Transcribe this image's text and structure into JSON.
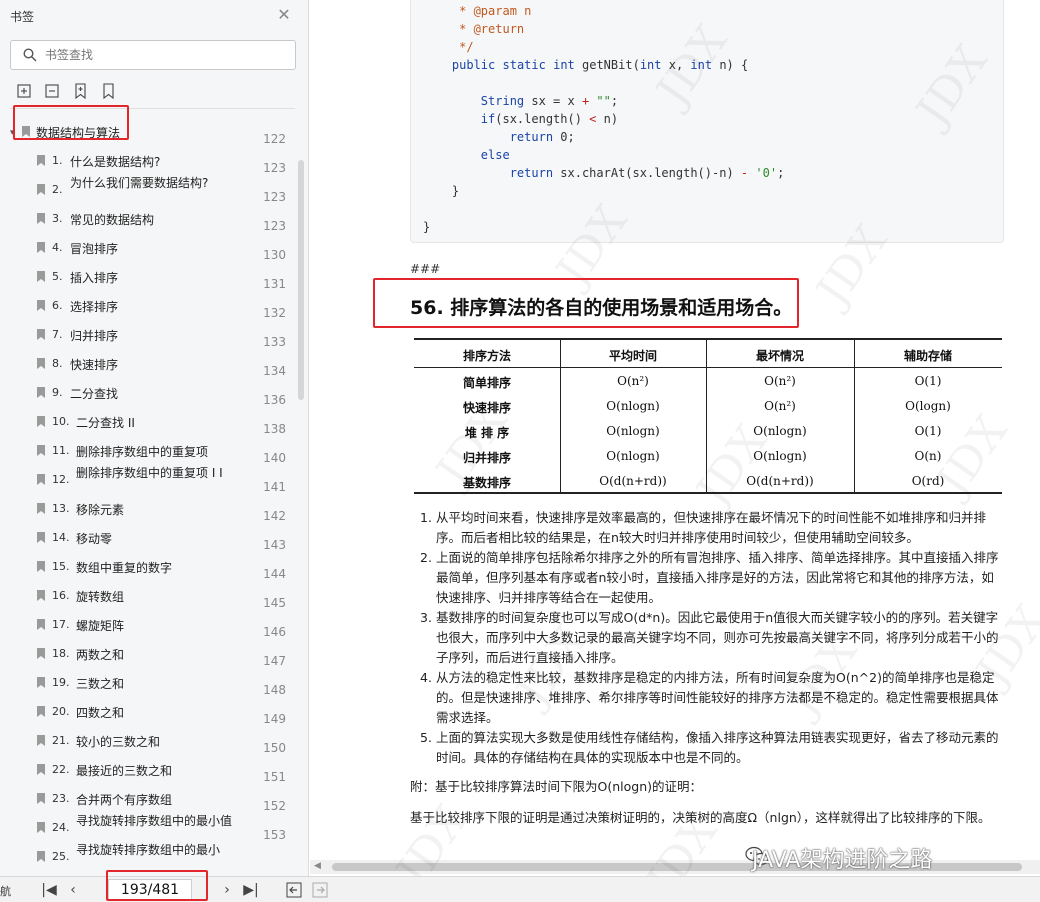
{
  "sidebar": {
    "title": "书签",
    "search_placeholder": "书签查找",
    "root": {
      "label": "数据结构与算法",
      "page": "122"
    },
    "items": [
      {
        "num": "1.",
        "label": "什么是数据结构?",
        "page": "123"
      },
      {
        "num": "2.",
        "label": "为什么我们需要数据结构?",
        "page": "123"
      },
      {
        "num": "3.",
        "label": "常见的数据结构",
        "page": "123"
      },
      {
        "num": "4.",
        "label": "冒泡排序",
        "page": "130"
      },
      {
        "num": "5.",
        "label": "插入排序",
        "page": "131"
      },
      {
        "num": "6.",
        "label": "选择排序",
        "page": "132"
      },
      {
        "num": "7.",
        "label": "归并排序",
        "page": "133"
      },
      {
        "num": "8.",
        "label": "快速排序",
        "page": "134"
      },
      {
        "num": "9.",
        "label": "二分查找",
        "page": "136"
      },
      {
        "num": "10.",
        "label": "二分查找 II",
        "page": "138"
      },
      {
        "num": "11.",
        "label": "删除排序数组中的重复项",
        "page": "140"
      },
      {
        "num": "12.",
        "label": "删除排序数组中的重复项 I I",
        "page": "141"
      },
      {
        "num": "13.",
        "label": "移除元素",
        "page": "142"
      },
      {
        "num": "14.",
        "label": "移动零",
        "page": "143"
      },
      {
        "num": "15.",
        "label": "数组中重复的数字",
        "page": "144"
      },
      {
        "num": "16.",
        "label": "旋转数组",
        "page": "145"
      },
      {
        "num": "17.",
        "label": "螺旋矩阵",
        "page": "146"
      },
      {
        "num": "18.",
        "label": "两数之和",
        "page": "147"
      },
      {
        "num": "19.",
        "label": "三数之和",
        "page": "148"
      },
      {
        "num": "20.",
        "label": "四数之和",
        "page": "149"
      },
      {
        "num": "21.",
        "label": "较小的三数之和",
        "page": "150"
      },
      {
        "num": "22.",
        "label": "最接近的三数之和",
        "page": "151"
      },
      {
        "num": "23.",
        "label": "合并两个有序数组",
        "page": "152"
      },
      {
        "num": "24.",
        "label": "寻找旋转排序数组中的最小值",
        "page": "153"
      },
      {
        "num": "25.",
        "label": "寻找旋转排序数组中的最小",
        "page": ""
      }
    ]
  },
  "bottom_bar": {
    "nav_label": "航",
    "page_indicator": "193/481"
  },
  "code": {
    "lines": [
      "     * @param n",
      "     * @return",
      "     */",
      "    public static int getNBit(int x, int n) {",
      "",
      "        String sx = x + \"\";",
      "        if(sx.length() < n)",
      "            return 0;",
      "        else",
      "            return sx.charAt(sx.length()-n) - '0';",
      "    }",
      "",
      "}"
    ]
  },
  "content": {
    "hashes": "###",
    "section_title": "56. 排序算法的各自的使用场景和适用场合。",
    "table": {
      "headers": [
        "排序方法",
        "平均时间",
        "最坏情况",
        "辅助存储"
      ],
      "rows": [
        [
          "简单排序",
          "O(n²)",
          "O(n²)",
          "O(1)"
        ],
        [
          "快速排序",
          "O(nlogn)",
          "O(n²)",
          "O(logn)"
        ],
        [
          "堆 排 序",
          "O(nlogn)",
          "O(nlogn)",
          "O(1)"
        ],
        [
          "归并排序",
          "O(nlogn)",
          "O(nlogn)",
          "O(n)"
        ],
        [
          "基数排序",
          "O(d(n+rd))",
          "O(d(n+rd))",
          "O(rd)"
        ]
      ]
    },
    "notes": [
      {
        "num": "1.",
        "text": "从平均时间来看，快速排序是效率最高的，但快速排序在最坏情况下的时间性能不如堆排序和归并排序。而后者相比较的结果是，在n较大时归并排序使用时间较少，但使用辅助空间较多。"
      },
      {
        "num": "2.",
        "text": "上面说的简单排序包括除希尔排序之外的所有冒泡排序、插入排序、简单选择排序。其中直接插入排序最简单，但序列基本有序或者n较小时，直接插入排序是好的方法，因此常将它和其他的排序方法，如快速排序、归并排序等结合在一起使用。"
      },
      {
        "num": "3.",
        "text": "基数排序的时间复杂度也可以写成O(d*n)。因此它最使用于n值很大而关键字较小的的序列。若关键字也很大，而序列中大多数记录的最高关键字均不同，则亦可先按最高关键字不同，将序列分成若干小的子序列，而后进行直接插入排序。"
      },
      {
        "num": "4.",
        "text": "从方法的稳定性来比较，基数排序是稳定的内排方法，所有时间复杂度为O(n^2)的简单排序也是稳定的。但是快速排序、堆排序、希尔排序等时间性能较好的排序方法都是不稳定的。稳定性需要根据具体需求选择。"
      },
      {
        "num": "5.",
        "text": "上面的算法实现大多数是使用线性存储结构，像插入排序这种算法用链表实现更好，省去了移动元素的时间。具体的存储结构在具体的实现版本中也是不同的。"
      }
    ],
    "appendix": "附：基于比较排序算法时间下限为O(nlogn)的证明：",
    "proof": "基于比较排序下限的证明是通过决策树证明的，决策树的高度Ω（nlgn），这样就得出了比较排序的下限。"
  },
  "watermark": {
    "brand": "JAVA架构进阶之路",
    "tile": "JDX"
  },
  "colors": {
    "highlight_red": "#e3262b",
    "sidebar_bg": "#f5f6f7"
  }
}
